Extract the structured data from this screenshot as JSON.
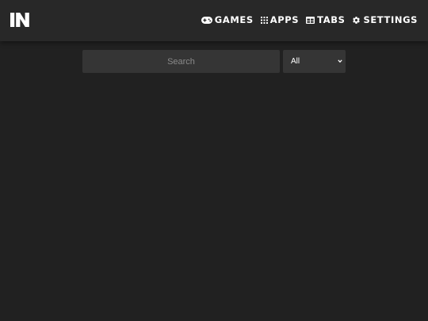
{
  "header": {
    "logo_text": "IN",
    "nav": [
      {
        "label": "GAMES",
        "icon": "gamepad-icon"
      },
      {
        "label": "APPS",
        "icon": "grid-dots-icon"
      },
      {
        "label": "TABS",
        "icon": "tabs-table-icon"
      },
      {
        "label": "SETTINGS",
        "icon": "gear-icon"
      }
    ]
  },
  "search": {
    "placeholder": "Search",
    "value": ""
  },
  "filter": {
    "selected": "All"
  },
  "colors": {
    "background": "#212121",
    "topbar": "#282828",
    "input_bg": "#353535",
    "text": "#ffffff",
    "placeholder": "#8a8a8a"
  }
}
